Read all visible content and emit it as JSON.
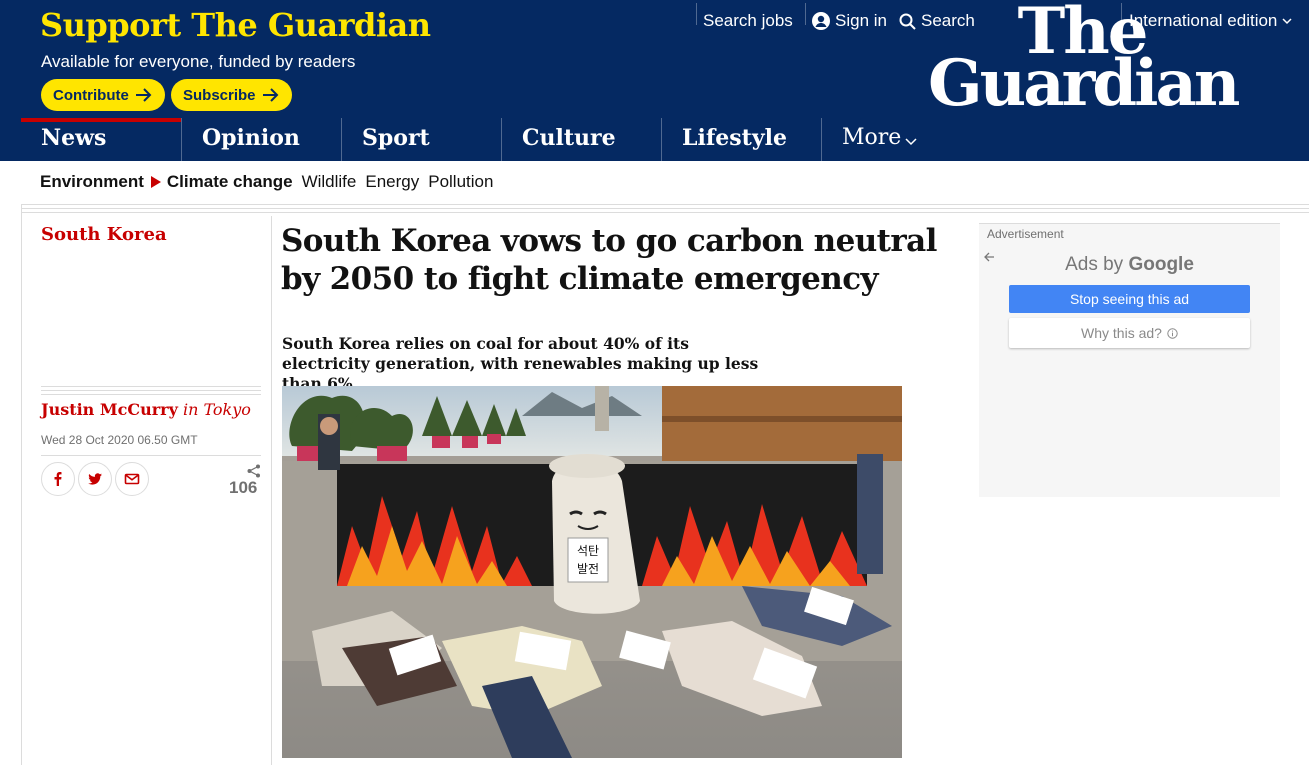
{
  "header": {
    "support_title": "Support The Guardian",
    "support_subtitle": "Available for everyone, funded by readers",
    "contribute_label": "Contribute",
    "subscribe_label": "Subscribe",
    "search_jobs_label": "Search jobs",
    "sign_in_label": "Sign in",
    "search_label": "Search",
    "edition_label": "International edition",
    "logo_line1": "The",
    "logo_line2": "Guardian",
    "colors": {
      "brand_blue": "#052962",
      "support_yellow": "#ffe500",
      "news_red": "#c70000"
    }
  },
  "nav": {
    "pillars": [
      "News",
      "Opinion",
      "Sport",
      "Culture",
      "Lifestyle"
    ],
    "more_label": "More",
    "active": "News"
  },
  "subnav": {
    "section": "Environment",
    "subsection": "Climate change",
    "items": [
      "Wildlife",
      "Energy",
      "Pollution"
    ]
  },
  "article": {
    "series": "South Korea",
    "headline": "South Korea vows to go carbon neutral by 2050 to fight climate emergency",
    "standfirst": "South Korea relies on coal for about 40% of its electricity generation, with renewables making up less than 6%",
    "author": "Justin McCurry",
    "location": "in Tokyo",
    "date": "Wed 28 Oct 2020 06.50 GMT",
    "share_count": "106",
    "image_sign_line1": "석탄",
    "image_sign_line2": "발전"
  },
  "ad": {
    "label": "Advertisement",
    "ads_by": "Ads by",
    "ads_by_brand": "Google",
    "stop_label": "Stop seeing this ad",
    "why_label": "Why this ad?"
  }
}
